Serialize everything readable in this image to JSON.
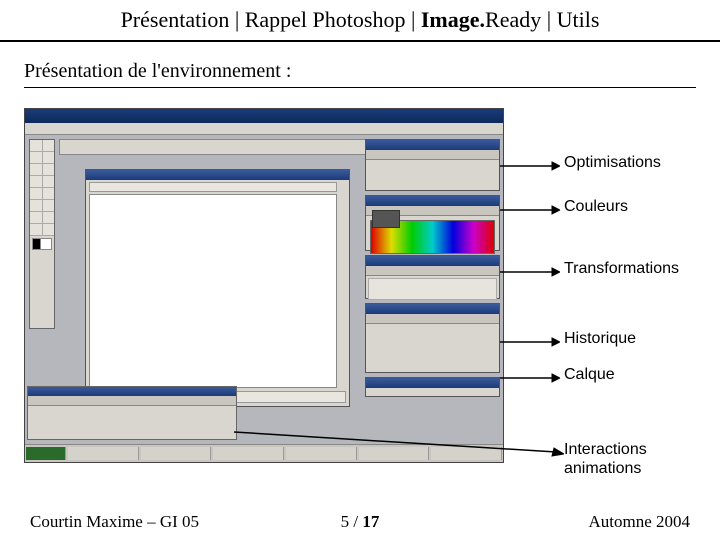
{
  "header": {
    "seg1": "Présentation | Rappel Photoshop | ",
    "seg2_bold": "Image.",
    "seg3": "Ready | Utils"
  },
  "subtitle": "Présentation de l'environnement :",
  "annotations": {
    "optimisations": "Optimisations",
    "couleurs": "Couleurs",
    "transformations": "Transformations",
    "historique": "Historique",
    "calque": "Calque",
    "interactions_l1": "Interactions",
    "interactions_l2": "animations"
  },
  "footer": {
    "author": "Courtin Maxime – GI 05",
    "page_current": "5",
    "page_sep": " / ",
    "page_total": "17",
    "term": "Automne 2004"
  }
}
